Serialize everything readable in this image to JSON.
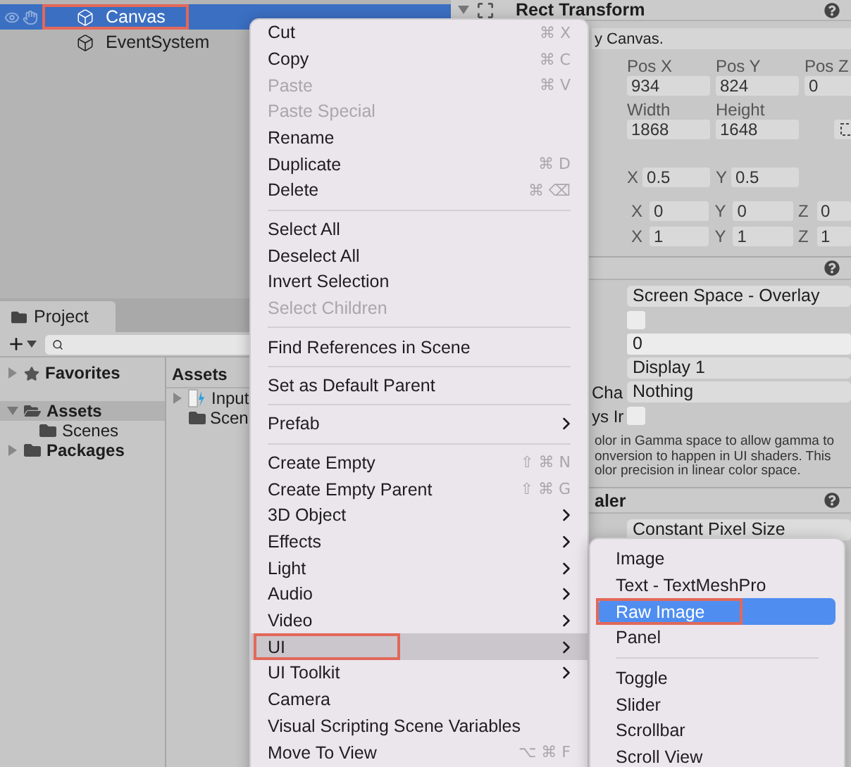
{
  "hierarchy": {
    "items": [
      {
        "label": "Canvas",
        "selected": true,
        "annotated": true
      },
      {
        "label": "EventSystem",
        "selected": false,
        "annotated": false
      }
    ]
  },
  "project": {
    "tab": "Project",
    "tree": [
      {
        "label": "Favorites",
        "kind": "favorites",
        "selected": false,
        "expanded": false
      },
      {
        "label": "Assets",
        "kind": "folder",
        "selected": true,
        "expanded": true,
        "children": [
          {
            "label": "Scenes",
            "kind": "folder",
            "selected": false
          }
        ]
      },
      {
        "label": "Packages",
        "kind": "folder",
        "selected": false,
        "expanded": false
      }
    ],
    "assets_header": "Assets",
    "assets": [
      {
        "label": "Input",
        "kind": "input-asset"
      },
      {
        "label": "Scen",
        "kind": "folder"
      }
    ]
  },
  "inspector": {
    "title": "Rect Transform",
    "note": "y Canvas.",
    "position": [
      {
        "label": "Pos X",
        "value": "934"
      },
      {
        "label": "Pos Y",
        "value": "824"
      },
      {
        "label": "Pos Z",
        "value": "0"
      }
    ],
    "size": [
      {
        "label": "Width",
        "value": "1868"
      },
      {
        "label": "Height",
        "value": "1648"
      }
    ],
    "pivot": [
      {
        "axis": "X",
        "value": "0.5"
      },
      {
        "axis": "Y",
        "value": "0.5"
      }
    ],
    "vector_rows": [
      [
        {
          "axis": "X",
          "value": "0"
        },
        {
          "axis": "Y",
          "value": "0"
        },
        {
          "axis": "Z",
          "value": "0"
        }
      ],
      [
        {
          "axis": "X",
          "value": "1"
        },
        {
          "axis": "Y",
          "value": "1"
        },
        {
          "axis": "Z",
          "value": "1"
        }
      ]
    ],
    "canvas_rows": [
      {
        "kind": "dropdown",
        "value": "Screen Space - Overlay"
      },
      {
        "kind": "checkbox",
        "checked": false
      },
      {
        "kind": "field",
        "value": "0"
      },
      {
        "kind": "dropdown",
        "value": "Display 1"
      },
      {
        "kind": "dropdown",
        "label": "Cha",
        "value": "Nothing"
      },
      {
        "kind": "checkbox",
        "label": "ys Ir",
        "checked": false
      }
    ],
    "canvas_note_lines": [
      "olor in Gamma space to allow gamma to",
      "onversion to happen in UI shaders. This",
      "olor precision in linear color space."
    ],
    "scaler_title": "aler",
    "scaler_mode": "Constant Pixel Size"
  },
  "context_menu": {
    "items": [
      {
        "kind": "item",
        "label": "Cut",
        "shortcut": "⌘ X",
        "disabled": false,
        "submenu": false,
        "selected": false,
        "annotated": false
      },
      {
        "kind": "item",
        "label": "Copy",
        "shortcut": "⌘ C",
        "disabled": false,
        "submenu": false,
        "selected": false,
        "annotated": false
      },
      {
        "kind": "item",
        "label": "Paste",
        "shortcut": "⌘ V",
        "disabled": true,
        "submenu": false,
        "selected": false,
        "annotated": false
      },
      {
        "kind": "item",
        "label": "Paste Special",
        "disabled": true,
        "submenu": false,
        "selected": false,
        "annotated": false
      },
      {
        "kind": "item",
        "label": "Rename",
        "disabled": false,
        "submenu": false,
        "selected": false,
        "annotated": false
      },
      {
        "kind": "item",
        "label": "Duplicate",
        "shortcut": "⌘ D",
        "disabled": false,
        "submenu": false,
        "selected": false,
        "annotated": false
      },
      {
        "kind": "item",
        "label": "Delete",
        "shortcut": "⌘ ⌫",
        "disabled": false,
        "submenu": false,
        "selected": false,
        "annotated": false
      },
      {
        "kind": "separator"
      },
      {
        "kind": "item",
        "label": "Select All",
        "disabled": false,
        "submenu": false,
        "selected": false,
        "annotated": false
      },
      {
        "kind": "item",
        "label": "Deselect All",
        "disabled": false,
        "submenu": false,
        "selected": false,
        "annotated": false
      },
      {
        "kind": "item",
        "label": "Invert Selection",
        "disabled": false,
        "submenu": false,
        "selected": false,
        "annotated": false
      },
      {
        "kind": "item",
        "label": "Select Children",
        "disabled": true,
        "submenu": false,
        "selected": false,
        "annotated": false
      },
      {
        "kind": "separator"
      },
      {
        "kind": "item",
        "label": "Find References in Scene",
        "disabled": false,
        "submenu": false,
        "selected": false,
        "annotated": false
      },
      {
        "kind": "separator"
      },
      {
        "kind": "item",
        "label": "Set as Default Parent",
        "disabled": false,
        "submenu": false,
        "selected": false,
        "annotated": false
      },
      {
        "kind": "separator"
      },
      {
        "kind": "item",
        "label": "Prefab",
        "disabled": false,
        "submenu": true,
        "selected": false,
        "annotated": false
      },
      {
        "kind": "separator"
      },
      {
        "kind": "item",
        "label": "Create Empty",
        "shortcut": "⇧ ⌘ N",
        "disabled": false,
        "submenu": false,
        "selected": false,
        "annotated": false
      },
      {
        "kind": "item",
        "label": "Create Empty Parent",
        "shortcut": "⇧ ⌘ G",
        "disabled": false,
        "submenu": false,
        "selected": false,
        "annotated": false
      },
      {
        "kind": "item",
        "label": "3D Object",
        "disabled": false,
        "submenu": true,
        "selected": false,
        "annotated": false
      },
      {
        "kind": "item",
        "label": "Effects",
        "disabled": false,
        "submenu": true,
        "selected": false,
        "annotated": false
      },
      {
        "kind": "item",
        "label": "Light",
        "disabled": false,
        "submenu": true,
        "selected": false,
        "annotated": false
      },
      {
        "kind": "item",
        "label": "Audio",
        "disabled": false,
        "submenu": true,
        "selected": false,
        "annotated": false
      },
      {
        "kind": "item",
        "label": "Video",
        "disabled": false,
        "submenu": true,
        "selected": false,
        "annotated": false
      },
      {
        "kind": "item",
        "label": "UI",
        "disabled": false,
        "submenu": true,
        "selected": true,
        "annotated": true
      },
      {
        "kind": "item",
        "label": "UI Toolkit",
        "disabled": false,
        "submenu": true,
        "selected": false,
        "annotated": false
      },
      {
        "kind": "item",
        "label": "Camera",
        "disabled": false,
        "submenu": false,
        "selected": false,
        "annotated": false
      },
      {
        "kind": "item",
        "label": "Visual Scripting Scene Variables",
        "disabled": false,
        "submenu": false,
        "selected": false,
        "annotated": false
      },
      {
        "kind": "item",
        "label": "Move To View",
        "shortcut": "⌥ ⌘ F",
        "disabled": false,
        "submenu": false,
        "selected": false,
        "annotated": false
      }
    ]
  },
  "submenu": {
    "items": [
      {
        "kind": "item",
        "label": "Image",
        "selected": false,
        "annotated": false
      },
      {
        "kind": "item",
        "label": "Text - TextMeshPro",
        "selected": false,
        "annotated": false
      },
      {
        "kind": "item",
        "label": "Raw Image",
        "selected": true,
        "annotated": true
      },
      {
        "kind": "item",
        "label": "Panel",
        "selected": false,
        "annotated": false
      },
      {
        "kind": "separator"
      },
      {
        "kind": "item",
        "label": "Toggle",
        "selected": false,
        "annotated": false
      },
      {
        "kind": "item",
        "label": "Slider",
        "selected": false,
        "annotated": false
      },
      {
        "kind": "item",
        "label": "Scrollbar",
        "selected": false,
        "annotated": false
      },
      {
        "kind": "item",
        "label": "Scroll View",
        "selected": false,
        "annotated": false
      }
    ]
  }
}
